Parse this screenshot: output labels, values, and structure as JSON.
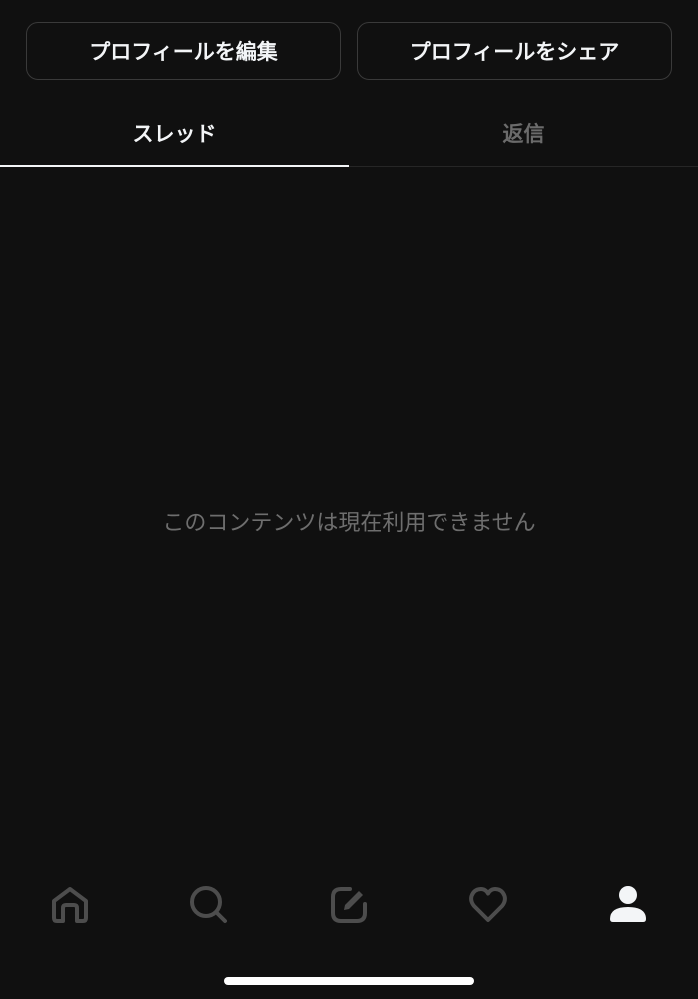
{
  "profile_actions": {
    "edit_label": "プロフィールを編集",
    "share_label": "プロフィールをシェア"
  },
  "tabs": [
    {
      "label": "スレッド",
      "active": true
    },
    {
      "label": "返信",
      "active": false
    }
  ],
  "feed": {
    "empty_message": "このコンテンツは現在利用できません"
  },
  "bottom_nav": {
    "items": [
      {
        "icon": "home-icon",
        "active": false
      },
      {
        "icon": "search-icon",
        "active": false
      },
      {
        "icon": "compose-icon",
        "active": false
      },
      {
        "icon": "heart-icon",
        "active": false
      },
      {
        "icon": "profile-icon",
        "active": true
      }
    ]
  },
  "colors": {
    "background": "#101010",
    "text_primary": "#f3f5f7",
    "text_muted": "#6e6e6e",
    "border": "#3a3a3a",
    "icon_inactive": "#4d4d4d"
  }
}
